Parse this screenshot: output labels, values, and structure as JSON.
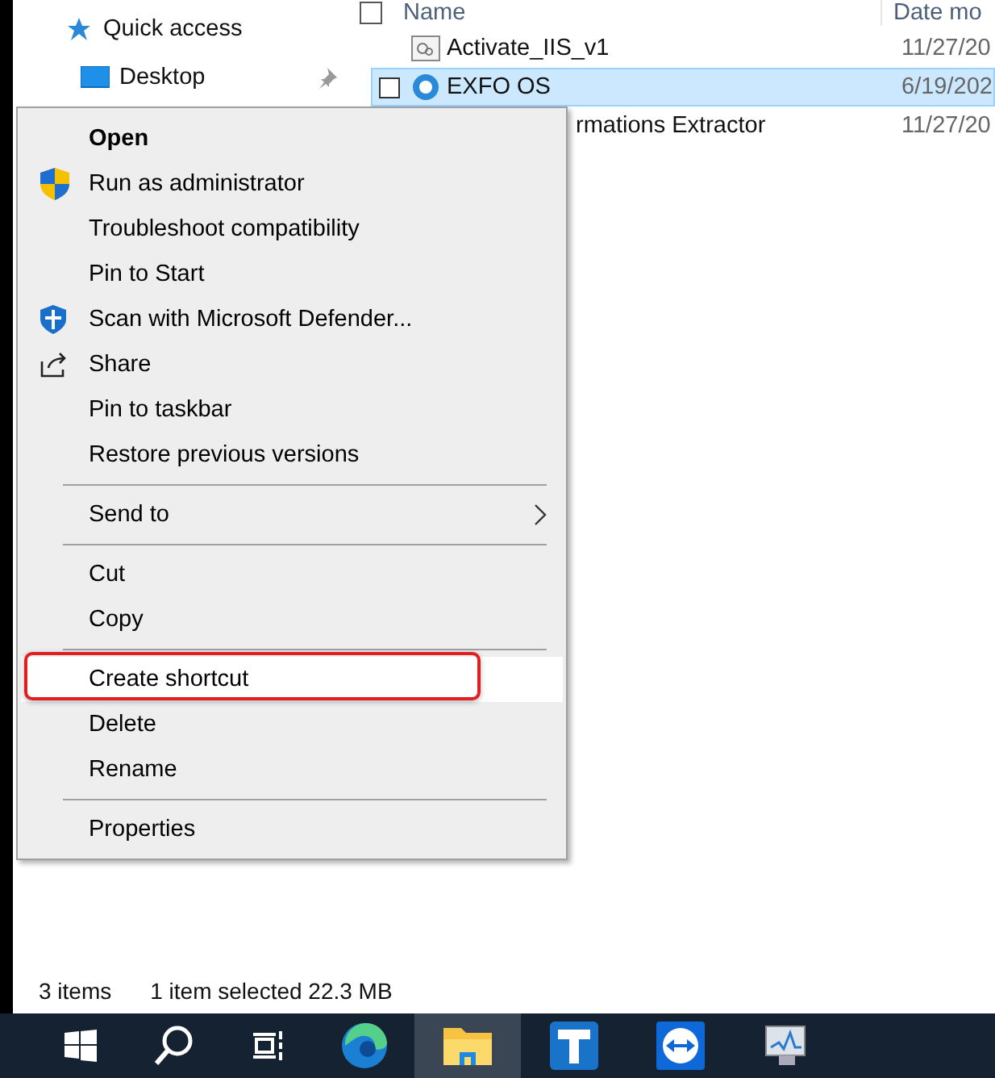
{
  "sidebar": {
    "items": [
      {
        "label": "Quick access",
        "kind": "star"
      },
      {
        "label": "Desktop",
        "kind": "desktop"
      }
    ]
  },
  "file_list": {
    "select_all_checked": false,
    "columns": [
      "Name",
      "Date mo"
    ],
    "rows": [
      {
        "name": "Activate_IIS_v1",
        "date": "11/27/20",
        "selected": false
      },
      {
        "name": "EXFO OS",
        "date": "6/19/202",
        "selected": true
      },
      {
        "name": "rmations Extractor",
        "date": "11/27/20",
        "selected": false
      }
    ]
  },
  "context_menu": {
    "items": [
      {
        "kind": "default",
        "label": "Open",
        "selected": false,
        "annotated": false
      },
      {
        "kind": "shield",
        "label": "Run as administrator",
        "selected": false,
        "annotated": false
      },
      {
        "kind": "plain",
        "label": "Troubleshoot compatibility",
        "selected": false,
        "annotated": false
      },
      {
        "kind": "plain",
        "label": "Pin to Start",
        "selected": false,
        "annotated": false
      },
      {
        "kind": "defender",
        "label": "Scan with Microsoft Defender...",
        "selected": false,
        "annotated": false
      },
      {
        "kind": "share",
        "label": "Share",
        "selected": false,
        "annotated": false
      },
      {
        "kind": "plain",
        "label": "Pin to taskbar",
        "selected": false,
        "annotated": false
      },
      {
        "kind": "plain",
        "label": "Restore previous versions",
        "selected": false,
        "annotated": false
      },
      {
        "kind": "separator"
      },
      {
        "kind": "submenu",
        "label": "Send to",
        "selected": false,
        "annotated": false
      },
      {
        "kind": "separator"
      },
      {
        "kind": "plain",
        "label": "Cut",
        "selected": false,
        "annotated": false
      },
      {
        "kind": "plain",
        "label": "Copy",
        "selected": false,
        "annotated": false
      },
      {
        "kind": "separator"
      },
      {
        "kind": "plain",
        "label": "Create shortcut",
        "selected": true,
        "annotated": true
      },
      {
        "kind": "plain",
        "label": "Delete",
        "selected": false,
        "annotated": false
      },
      {
        "kind": "plain",
        "label": "Rename",
        "selected": false,
        "annotated": false
      },
      {
        "kind": "separator"
      },
      {
        "kind": "plain",
        "label": "Properties",
        "selected": false,
        "annotated": false
      }
    ]
  },
  "status_bar": {
    "item_count": "3 items",
    "selection": "1 item selected  22.3 MB"
  },
  "taskbar": {
    "items": [
      {
        "kind": "start",
        "active": false
      },
      {
        "kind": "search",
        "active": false
      },
      {
        "kind": "taskview",
        "active": false
      },
      {
        "kind": "edge",
        "active": false
      },
      {
        "kind": "explorer",
        "active": true
      },
      {
        "kind": "t-app",
        "active": false
      },
      {
        "kind": "remote",
        "active": false
      },
      {
        "kind": "monitor",
        "active": false
      }
    ]
  }
}
